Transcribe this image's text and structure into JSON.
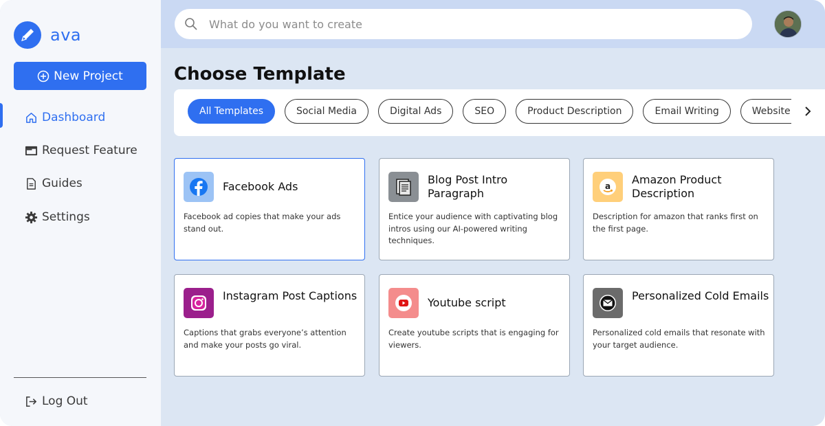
{
  "app": {
    "name": "ava",
    "brand_color": "#2f6ff0"
  },
  "sidebar": {
    "new_project_label": "New Project",
    "items": [
      {
        "label": "Dashboard",
        "icon": "home-icon",
        "active": true
      },
      {
        "label": "Request Feature",
        "icon": "window-icon",
        "active": false
      },
      {
        "label": "Guides",
        "icon": "document-icon",
        "active": false
      },
      {
        "label": "Settings",
        "icon": "gear-icon",
        "active": false
      }
    ],
    "logout_label": "Log Out"
  },
  "search": {
    "placeholder": "What do you want to create",
    "value": ""
  },
  "main": {
    "title": "Choose Template",
    "filters": [
      "All Templates",
      "Social Media",
      "Digital Ads",
      "SEO",
      "Product Description",
      "Email Writing",
      "Website Copy"
    ],
    "active_filter": "All Templates",
    "templates": [
      {
        "title": "Facebook Ads",
        "description": "Facebook  ad copies that make your ads stand out.",
        "icon": "facebook-icon",
        "icon_bg": "#9cc3f5",
        "selected": true
      },
      {
        "title": "Blog Post Intro Paragraph",
        "description": "Entice your audience with captivating blog intros using our AI-powered writing techniques.",
        "icon": "blog-document-icon",
        "icon_bg": "#8a8f94",
        "selected": false
      },
      {
        "title": "Amazon Product Description",
        "description": "Description for amazon that ranks first on the first page.",
        "icon": "amazon-icon",
        "icon_bg": "#ffcf7a",
        "selected": false
      },
      {
        "title": "Instagram Post Captions",
        "description": "Captions that grabs everyone’s attention and make your posts go viral.",
        "icon": "instagram-icon",
        "icon_bg": "#9b1f8c",
        "selected": false
      },
      {
        "title": "Youtube script",
        "description": "Create youtube scripts that is engaging for viewers.",
        "icon": "youtube-icon",
        "icon_bg": "#f48c8c",
        "selected": false
      },
      {
        "title": "Personalized Cold Emails",
        "description": "Personalized cold emails that resonate with your target audience.",
        "icon": "email-icon",
        "icon_bg": "#6b6b6b",
        "selected": false
      }
    ]
  }
}
